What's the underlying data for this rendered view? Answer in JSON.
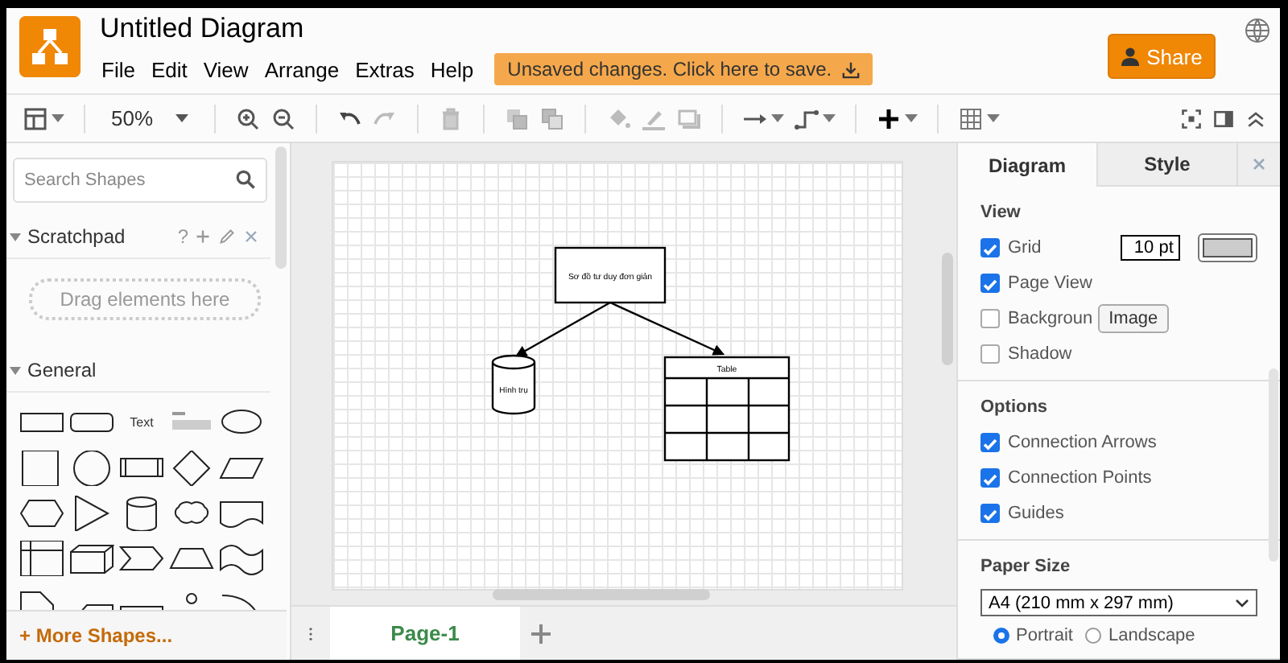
{
  "app": {
    "title": "Untitled Diagram",
    "menu": [
      "File",
      "Edit",
      "View",
      "Arrange",
      "Extras",
      "Help"
    ],
    "save_notice": "Unsaved changes. Click here to save.",
    "share_button": "Share"
  },
  "toolbar": {
    "zoom": "50%"
  },
  "sidebar": {
    "search": {
      "placeholder": "Search Shapes"
    },
    "sections": [
      {
        "kind": "scratchpad",
        "title": "Scratchpad",
        "expanded": true,
        "help": "?",
        "drop_hint": "Drag elements here"
      },
      {
        "kind": "palette",
        "title": "General",
        "expanded": true,
        "text_shape": "Text"
      }
    ],
    "more_shapes": "+ More Shapes..."
  },
  "diagram": {
    "nodes": [
      {
        "kind": "box",
        "label": "Sơ đồ tư duy đơn giản"
      },
      {
        "kind": "cylinder",
        "label": "Hình trụ"
      },
      {
        "kind": "table",
        "label": "Table"
      }
    ]
  },
  "pages": [
    {
      "label": "Page-1",
      "selected": true
    }
  ],
  "format_panel": {
    "tabs": [
      {
        "label": "Diagram",
        "selected": true
      },
      {
        "label": "Style",
        "selected": false
      }
    ],
    "view": {
      "title": "View",
      "items": [
        {
          "kind": "grid",
          "label": "Grid",
          "checked": true,
          "size": "10 pt"
        },
        {
          "kind": "checkbox",
          "label": "Page View",
          "checked": true
        },
        {
          "kind": "background",
          "label": "Backgroun",
          "checked": false,
          "button": "Image"
        },
        {
          "kind": "checkbox",
          "label": "Shadow",
          "checked": false
        }
      ]
    },
    "options": {
      "title": "Options",
      "items": [
        {
          "kind": "checkbox",
          "label": "Connection Arrows",
          "checked": true
        },
        {
          "kind": "checkbox",
          "label": "Connection Points",
          "checked": true
        },
        {
          "kind": "checkbox",
          "label": "Guides",
          "checked": true
        }
      ]
    },
    "paper": {
      "title": "Paper Size",
      "size": "A4 (210 mm x 297 mm)",
      "orientations": [
        {
          "label": "Portrait",
          "selected": true
        },
        {
          "label": "Landscape",
          "selected": false
        }
      ]
    }
  }
}
